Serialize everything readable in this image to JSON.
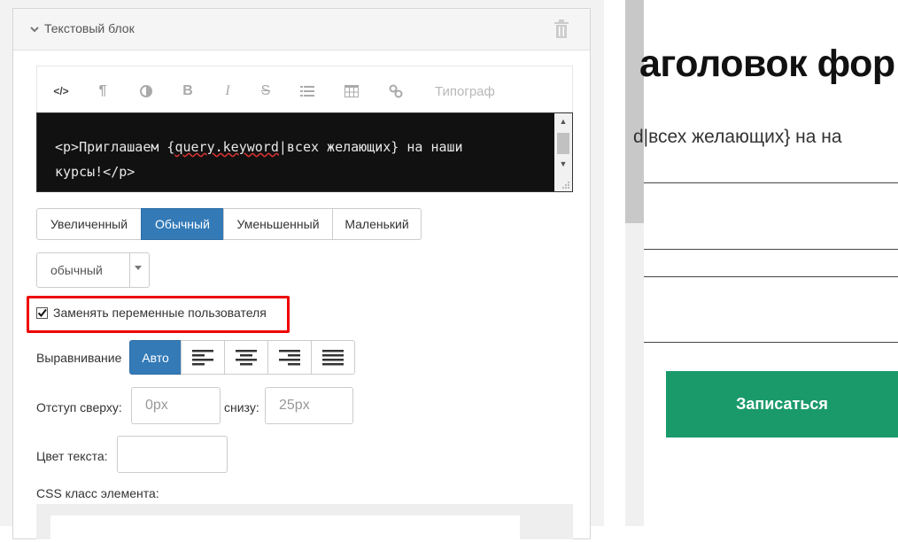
{
  "panel": {
    "title": "Текстовый блок"
  },
  "toolbar": {
    "code_icon": "</>",
    "paragraph_icon": "¶",
    "bold_icon": "B",
    "italic_icon": "I",
    "strike_icon": "S",
    "typograph_label": "Типограф"
  },
  "code": {
    "line1_a": "<p>Приглашаем {",
    "line1_u": "query.keyword",
    "line1_b": "|всех желающих} на наши",
    "line2": "курсы!</p>"
  },
  "sizes": {
    "items": [
      "Увеличенный",
      "Обычный",
      "Уменьшенный",
      "Маленький"
    ],
    "active": "Обычный"
  },
  "weight_select": {
    "value": "обычный"
  },
  "replace_vars": {
    "label": "Заменять переменные пользователя",
    "checked": true
  },
  "alignment": {
    "label": "Выравнивание",
    "auto_label": "Авто"
  },
  "padding": {
    "top_label": "Отступ сверху:",
    "top_placeholder": "0px",
    "bottom_label": "снизу:",
    "bottom_placeholder": "25px"
  },
  "text_color": {
    "label": "Цвет текста:"
  },
  "css_class": {
    "label": "CSS класс элемента:"
  },
  "preview": {
    "title": "аголовок фор",
    "subtitle": "d|всех желающих} на на",
    "button_label": "Записаться",
    "button_color": "#1a9a6b"
  },
  "colors": {
    "accent": "#337ab7",
    "highlight": "#e00000"
  }
}
